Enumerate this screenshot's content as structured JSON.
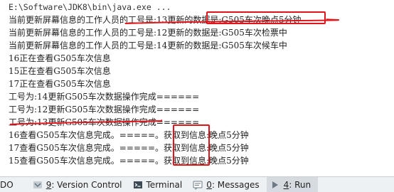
{
  "console": {
    "lines": [
      "E:\\Software\\JDK8\\bin\\java.exe ...",
      "当前更新屏幕信息的工作人员的工号是:13更新的数据是:G505车次晚点5分钟",
      "当前更新屏幕信息的工作人员的工号是:G505车次检票中",
      "当前更新屏幕信息的工作人员的工号是:14更新的数据是:G505车次候车中",
      "16正在查看G505车次信息",
      "15正在查看G505车次信息",
      "17正在查看G505车次信息",
      "工号为:14更新G505车次数据操作完成======",
      "工号为:12更新G505车次数据操作完成======",
      "工号为:13更新G505车次数据操作完成======",
      "16查看G505车次信息完成。=====。获取到信息:晚点5分钟",
      "17查看G505车次信息完成。=====。获取到信息:晚点5分钟",
      "15查看G505车次信息完成。=====。获取到信息:晚点5分钟"
    ],
    "line2_alt": "当前更新屏幕信息的工作人员的工号是:12更新的数据是:G505车次检票中"
  },
  "toolbar": {
    "todo_label": "DO",
    "version_control": {
      "key": "9",
      "label": ": Version Control"
    },
    "terminal": {
      "label": "Terminal"
    },
    "messages": {
      "key": "0",
      "label": ": Messages"
    },
    "run": {
      "key": "4",
      "label": ": Run"
    }
  },
  "colors": {
    "annotation_red": "#e0151a",
    "toolbar_bg": "#eef1f4",
    "console_text": "#222222"
  }
}
